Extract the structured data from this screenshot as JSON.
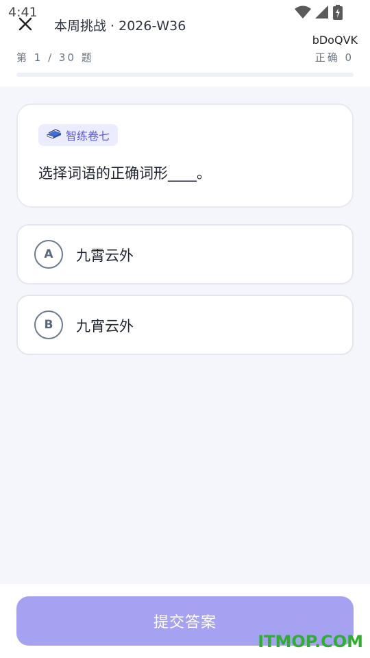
{
  "status_bar": {
    "time": "4:41",
    "icons": [
      "wifi-icon",
      "cellular-signal-icon",
      "battery-charging-icon"
    ]
  },
  "header": {
    "title": "本周挑战 · 2026-W36",
    "user_code": "bDoQVK",
    "progress_text": "第 1 / 30 题",
    "correct_text": "正确 0",
    "progress_fraction": 0
  },
  "question": {
    "tag_icon": "book-icon",
    "tag_label": "智练卷七",
    "text": "选择词语的正确词形____。"
  },
  "options": [
    {
      "letter": "A",
      "text": "九霄云外"
    },
    {
      "letter": "B",
      "text": "九宵云外"
    }
  ],
  "submit": {
    "label": "提交答案",
    "state": "disabled"
  },
  "watermark": "ITMOP.COM",
  "colors": {
    "accent": "#8f8cf0",
    "submit_disabled": "#a5a2f2",
    "tag_bg": "#ececff",
    "tag_text": "#5e5ad6",
    "watermark": "#2fae2f"
  }
}
